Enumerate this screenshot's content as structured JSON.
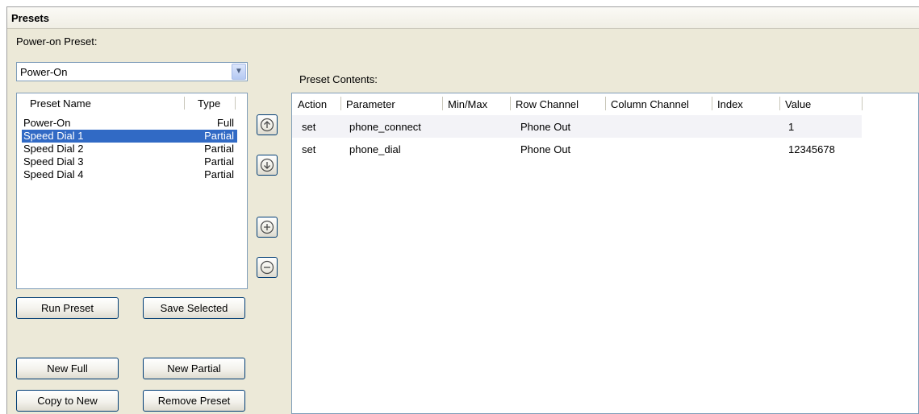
{
  "title": "Presets",
  "power_on_label": "Power-on Preset:",
  "power_on_value": "Power-On",
  "preset_list": {
    "headers": [
      "Preset Name",
      "Type"
    ],
    "rows": [
      {
        "name": "Power-On",
        "type": "Full"
      },
      {
        "name": "Speed Dial 1",
        "type": "Partial"
      },
      {
        "name": "Speed Dial 2",
        "type": "Partial"
      },
      {
        "name": "Speed Dial 3",
        "type": "Partial"
      },
      {
        "name": "Speed Dial 4",
        "type": "Partial"
      }
    ],
    "selected_name": "Speed Dial 1"
  },
  "buttons": {
    "run": "Run Preset",
    "save": "Save Selected",
    "new_full": "New Full",
    "new_partial": "New Partial",
    "copy": "Copy to New",
    "remove": "Remove Preset"
  },
  "side_icons": [
    "move-up-icon",
    "move-down-icon",
    "add-icon",
    "remove-icon"
  ],
  "contents_label": "Preset Contents:",
  "contents": {
    "headers": [
      "Action",
      "Parameter",
      "Min/Max",
      "Row Channel",
      "Column Channel",
      "Index",
      "Value"
    ],
    "rows": [
      {
        "action": "set",
        "parameter": "phone_connect",
        "minmax": "",
        "row_channel": "Phone Out",
        "column_channel": "",
        "index": "",
        "value": "1"
      },
      {
        "action": "set",
        "parameter": "phone_dial",
        "minmax": "",
        "row_channel": "Phone Out",
        "column_channel": "",
        "index": "",
        "value": "12345678"
      }
    ]
  },
  "colors": {
    "panel": "#ece9d8",
    "selection": "#316ac5",
    "border": "#7f9db9",
    "button_border": "#003c74"
  }
}
